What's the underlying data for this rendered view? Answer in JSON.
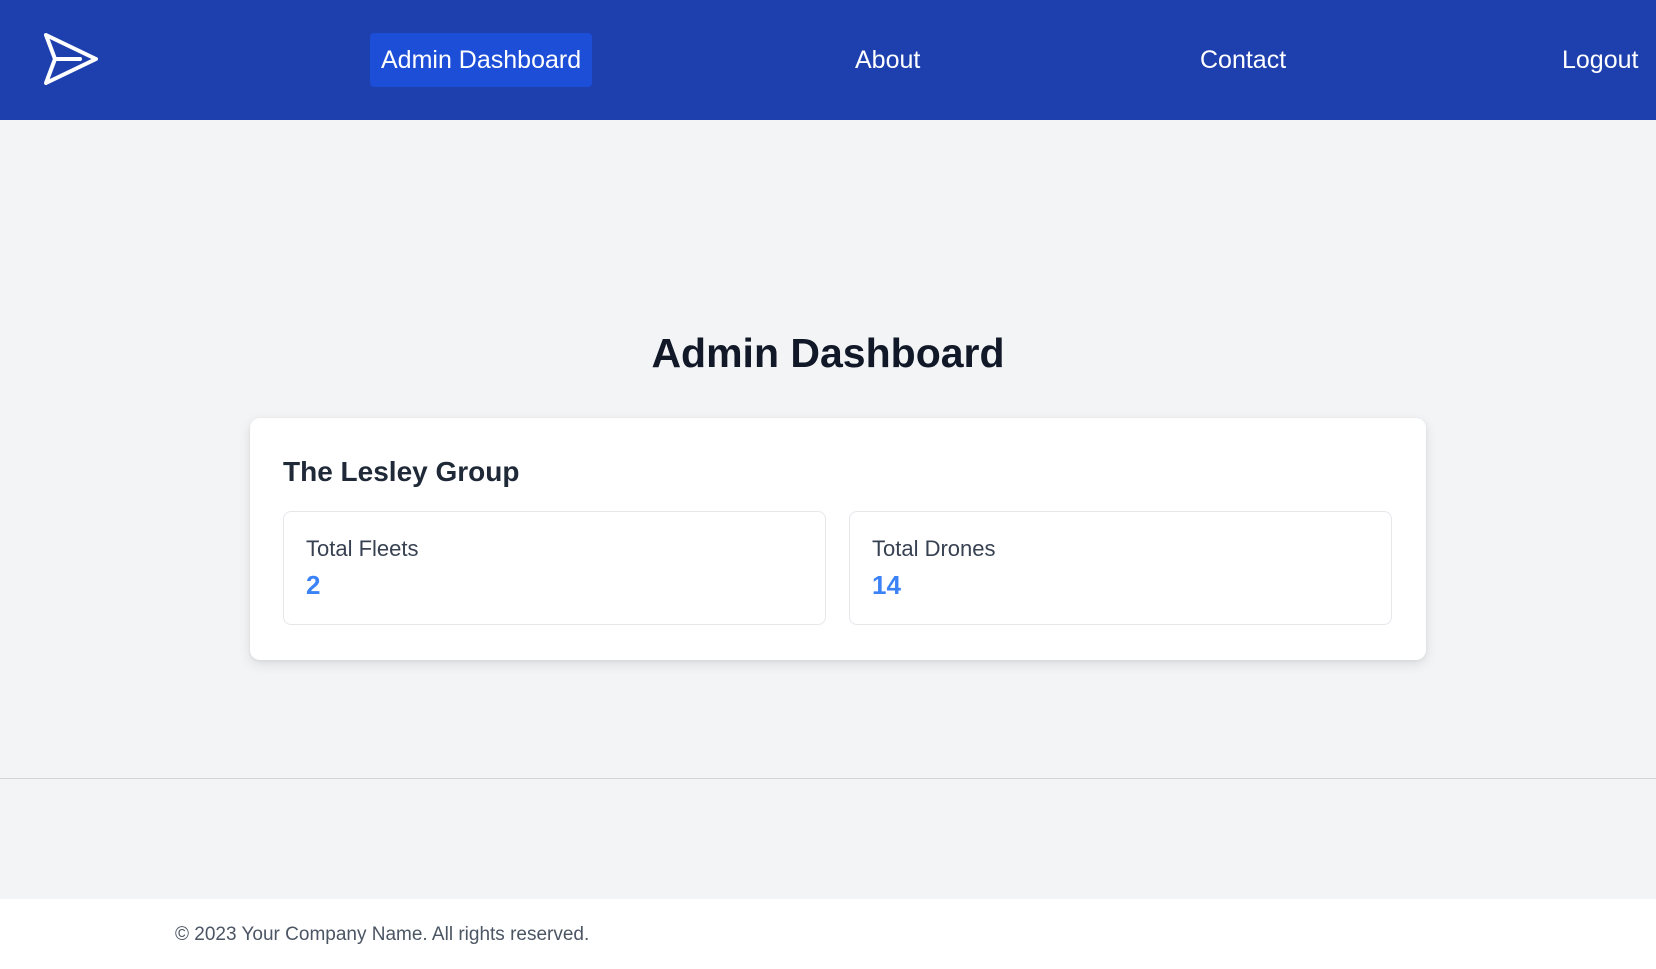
{
  "nav": {
    "links": [
      {
        "label": "Admin Dashboard",
        "active": true
      },
      {
        "label": "About",
        "active": false
      },
      {
        "label": "Contact",
        "active": false
      },
      {
        "label": "Logout",
        "active": false
      }
    ],
    "logo_icon": "paper-plane-icon"
  },
  "main": {
    "title": "Admin Dashboard",
    "organization": {
      "name": "The Lesley Group",
      "stats": [
        {
          "label": "Total Fleets",
          "value": "2"
        },
        {
          "label": "Total Drones",
          "value": "14"
        }
      ]
    }
  },
  "footer": {
    "text": "© 2023 Your Company Name. All rights reserved."
  },
  "colors": {
    "nav_bg": "#1e40af",
    "nav_active_bg": "#1d4ed8",
    "page_bg": "#f3f4f6",
    "stat_value": "#3b82f6"
  }
}
